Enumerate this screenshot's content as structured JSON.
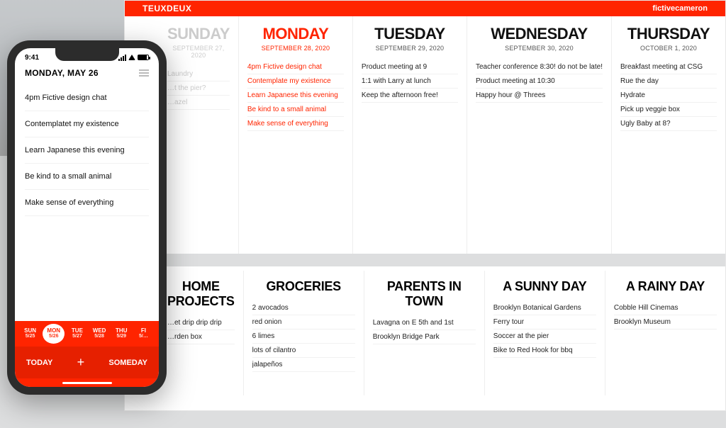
{
  "desktop": {
    "brand": "TEUXDEUX",
    "user": "fictivecameron",
    "days": [
      {
        "name": "SUNDAY",
        "date": "SEPTEMBER 27, 2020",
        "kind": "past",
        "tasks": [
          "Laundry",
          "…t the pier?",
          "…azel"
        ]
      },
      {
        "name": "MONDAY",
        "date": "SEPTEMBER 28, 2020",
        "kind": "today",
        "tasks": [
          "4pm Fictive design chat",
          "Contemplate my existence",
          "Learn Japanese this evening",
          "Be kind to a small animal",
          "Make sense of everything"
        ]
      },
      {
        "name": "TUESDAY",
        "date": "SEPTEMBER 29, 2020",
        "kind": "",
        "tasks": [
          "Product meeting at 9",
          "1:1 with Larry at lunch",
          "Keep the afternoon free!"
        ]
      },
      {
        "name": "WEDNESDAY",
        "date": "SEPTEMBER 30, 2020",
        "kind": "",
        "tasks": [
          "Teacher conference 8:30! do not be late!",
          "Product meeting at 10:30",
          "Happy hour @ Threes"
        ]
      },
      {
        "name": "THURSDAY",
        "date": "OCTOBER 1, 2020",
        "kind": "",
        "tasks": [
          "Breakfast meeting at CSG",
          "Rue the day",
          "Hydrate",
          "Pick up veggie box",
          "Ugly Baby at 8?"
        ]
      }
    ],
    "lists": [
      {
        "name": "HOME PROJECTS",
        "items": [
          "…et drip drip drip",
          "…rden box"
        ]
      },
      {
        "name": "GROCERIES",
        "items": [
          "2 avocados",
          "red onion",
          "6 limes",
          "lots of cilantro",
          "jalapeños"
        ]
      },
      {
        "name": "PARENTS IN TOWN",
        "items": [
          "Lavagna on E 5th and 1st",
          "Brooklyn Bridge Park"
        ]
      },
      {
        "name": "A SUNNY DAY",
        "items": [
          "Brooklyn Botanical Gardens",
          "Ferry tour",
          "Soccer at the pier",
          "Bike to Red Hook for bbq"
        ]
      },
      {
        "name": "A RAINY DAY",
        "items": [
          "Cobble Hill Cinemas",
          "Brooklyn Museum"
        ]
      }
    ]
  },
  "phone": {
    "time": "9:41",
    "title": "MONDAY, MAY 26",
    "tasks": [
      "4pm Fictive design chat",
      "Contemplatet my existence",
      "Learn Japanese this evening",
      "Be kind to a small animal",
      "Make sense of everything"
    ],
    "strip": [
      {
        "d": "SUN",
        "s": "5/25"
      },
      {
        "d": "MON",
        "s": "5/26",
        "selected": true
      },
      {
        "d": "TUE",
        "s": "5/27"
      },
      {
        "d": "WED",
        "s": "5/28"
      },
      {
        "d": "THU",
        "s": "5/29"
      },
      {
        "d": "FI",
        "s": "5/…"
      }
    ],
    "bottom": {
      "left": "TODAY",
      "mid": "+",
      "right": "SOMEDAY"
    }
  }
}
